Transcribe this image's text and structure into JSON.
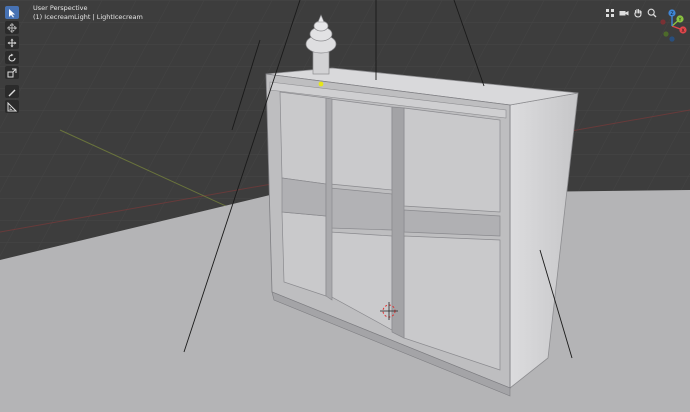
{
  "viewport": {
    "mode_label": "User Perspective",
    "object_label": "(1) IcecreamLight | LightIcecream"
  },
  "toolbar": {
    "tools": [
      {
        "icon": "select-cursor-icon",
        "active": true
      },
      {
        "icon": "cursor-3d-icon",
        "active": false
      },
      {
        "icon": "move-icon",
        "active": false
      },
      {
        "icon": "rotate-icon",
        "active": false
      },
      {
        "icon": "scale-icon",
        "active": false
      },
      {
        "icon": "annotate-icon",
        "active": false
      },
      {
        "icon": "measure-icon",
        "active": false
      }
    ]
  },
  "navigation": {
    "icons": [
      "view-grid-icon",
      "camera-icon",
      "hand-pan-icon",
      "zoom-icon"
    ]
  },
  "gizmo": {
    "axes": [
      "X",
      "Y",
      "Z"
    ],
    "colors": {
      "x": "#e0464b",
      "y": "#8bc441",
      "z": "#3f86d6"
    }
  },
  "colors": {
    "background": "#3d3d3d",
    "grid": "#484848",
    "floor": "#b3b3b5",
    "cabinet_front": "#bdbdbf",
    "cabinet_side": "#d3d3d5",
    "active_tool": "#4772b3"
  }
}
